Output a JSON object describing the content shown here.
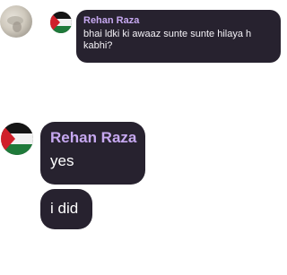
{
  "reply": {
    "sender": "Rehan Raza",
    "text": "bhai ldki ki awaaz sunte sunte hilaya h kabhi?"
  },
  "messages": [
    {
      "sender": "Rehan Raza",
      "text": "yes"
    },
    {
      "text": "i did"
    }
  ],
  "colors": {
    "bubble": "#27222f",
    "name": "#c6a8f0",
    "text": "#ffffff"
  }
}
